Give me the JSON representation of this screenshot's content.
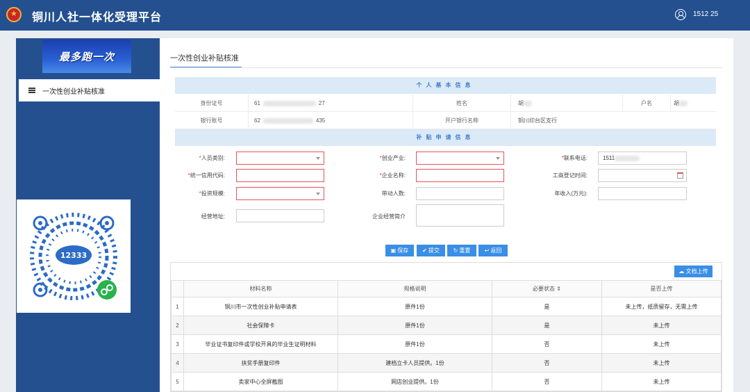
{
  "header": {
    "app_title": "铜川人社一体化受理平台",
    "user_name": "1512          25"
  },
  "sidebar": {
    "banner_text": "最多跑一次",
    "menu_item_label": "一次性创业补贴核准"
  },
  "page": {
    "tab_title": "一次性创业补贴核准"
  },
  "personal_info": {
    "section_title": "个人基本信息",
    "id_label": "身份证号",
    "id_value_start": "61",
    "id_value_end": "27",
    "name_label": "姓名",
    "name_value": "胡",
    "account_holder_label": "户名",
    "account_holder_value": "胡",
    "bank_account_label": "银行账号",
    "bank_account_start": "62",
    "bank_account_end": "435",
    "bank_name_label": "开户银行名称",
    "bank_name_value": "铜川印台区支行"
  },
  "subsidy_form": {
    "section_title": "补贴申请信息",
    "person_type_label": "人员类别:",
    "industry_label": "创业产业:",
    "phone_label": "联系电话:",
    "phone_value": "1511",
    "credit_code_label": "统一信用代码:",
    "company_name_label": "企业名称:",
    "reg_time_label": "工商登记时间:",
    "invest_scale_label": "投资规模:",
    "employees_label": "带动人数:",
    "annual_income_label": "年收入(万元):",
    "address_label": "经营地址:",
    "company_intro_label": "企业经营简介"
  },
  "actions": {
    "save": "保存",
    "submit": "提交",
    "reset": "重置",
    "back": "返回",
    "upload": "文档上传"
  },
  "materials_table": {
    "headers": [
      "材料名称",
      "规格说明",
      "必要状态 ⇕",
      "是否上传"
    ],
    "rows": [
      {
        "idx": "1",
        "name": "铜川市一次性创业补贴申请表",
        "spec": "原件1份",
        "required": "是",
        "uploaded": "未上传，纸质留存，无需上传"
      },
      {
        "idx": "2",
        "name": "社会保障卡",
        "spec": "原件1份",
        "required": "是",
        "uploaded": "未上传"
      },
      {
        "idx": "3",
        "name": "毕业证书复印件或学校开具的毕业生证明材料",
        "spec": "原件1份",
        "required": "否",
        "uploaded": "未上传"
      },
      {
        "idx": "4",
        "name": "扶贫手册复印件",
        "spec": "建档立卡人员提供。1份",
        "required": "否",
        "uploaded": "未上传"
      },
      {
        "idx": "5",
        "name": "卖家中心全屏截图",
        "spec": "网店创业提供。1份",
        "required": "否",
        "uploaded": "未上传"
      }
    ]
  },
  "colors": {
    "header_bg": "#24508f",
    "accent": "#3a8ee6",
    "section_bg": "#dce9f6",
    "required_border": "#e5535a"
  }
}
